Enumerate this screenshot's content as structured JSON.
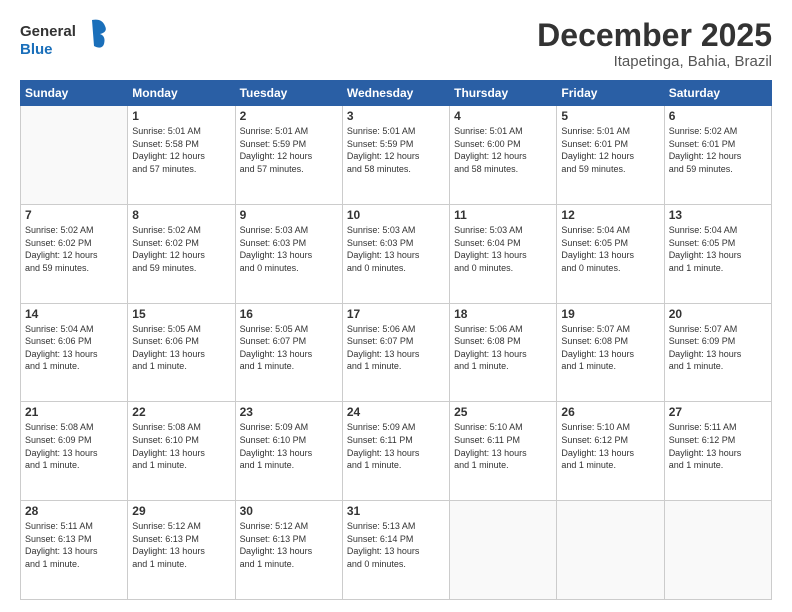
{
  "header": {
    "logo_line1": "General",
    "logo_line2": "Blue",
    "month": "December 2025",
    "location": "Itapetinga, Bahia, Brazil"
  },
  "weekdays": [
    "Sunday",
    "Monday",
    "Tuesday",
    "Wednesday",
    "Thursday",
    "Friday",
    "Saturday"
  ],
  "weeks": [
    [
      {
        "day": "",
        "info": ""
      },
      {
        "day": "1",
        "info": "Sunrise: 5:01 AM\nSunset: 5:58 PM\nDaylight: 12 hours\nand 57 minutes."
      },
      {
        "day": "2",
        "info": "Sunrise: 5:01 AM\nSunset: 5:59 PM\nDaylight: 12 hours\nand 57 minutes."
      },
      {
        "day": "3",
        "info": "Sunrise: 5:01 AM\nSunset: 5:59 PM\nDaylight: 12 hours\nand 58 minutes."
      },
      {
        "day": "4",
        "info": "Sunrise: 5:01 AM\nSunset: 6:00 PM\nDaylight: 12 hours\nand 58 minutes."
      },
      {
        "day": "5",
        "info": "Sunrise: 5:01 AM\nSunset: 6:01 PM\nDaylight: 12 hours\nand 59 minutes."
      },
      {
        "day": "6",
        "info": "Sunrise: 5:02 AM\nSunset: 6:01 PM\nDaylight: 12 hours\nand 59 minutes."
      }
    ],
    [
      {
        "day": "7",
        "info": "Sunrise: 5:02 AM\nSunset: 6:02 PM\nDaylight: 12 hours\nand 59 minutes."
      },
      {
        "day": "8",
        "info": "Sunrise: 5:02 AM\nSunset: 6:02 PM\nDaylight: 12 hours\nand 59 minutes."
      },
      {
        "day": "9",
        "info": "Sunrise: 5:03 AM\nSunset: 6:03 PM\nDaylight: 13 hours\nand 0 minutes."
      },
      {
        "day": "10",
        "info": "Sunrise: 5:03 AM\nSunset: 6:03 PM\nDaylight: 13 hours\nand 0 minutes."
      },
      {
        "day": "11",
        "info": "Sunrise: 5:03 AM\nSunset: 6:04 PM\nDaylight: 13 hours\nand 0 minutes."
      },
      {
        "day": "12",
        "info": "Sunrise: 5:04 AM\nSunset: 6:05 PM\nDaylight: 13 hours\nand 0 minutes."
      },
      {
        "day": "13",
        "info": "Sunrise: 5:04 AM\nSunset: 6:05 PM\nDaylight: 13 hours\nand 1 minute."
      }
    ],
    [
      {
        "day": "14",
        "info": "Sunrise: 5:04 AM\nSunset: 6:06 PM\nDaylight: 13 hours\nand 1 minute."
      },
      {
        "day": "15",
        "info": "Sunrise: 5:05 AM\nSunset: 6:06 PM\nDaylight: 13 hours\nand 1 minute."
      },
      {
        "day": "16",
        "info": "Sunrise: 5:05 AM\nSunset: 6:07 PM\nDaylight: 13 hours\nand 1 minute."
      },
      {
        "day": "17",
        "info": "Sunrise: 5:06 AM\nSunset: 6:07 PM\nDaylight: 13 hours\nand 1 minute."
      },
      {
        "day": "18",
        "info": "Sunrise: 5:06 AM\nSunset: 6:08 PM\nDaylight: 13 hours\nand 1 minute."
      },
      {
        "day": "19",
        "info": "Sunrise: 5:07 AM\nSunset: 6:08 PM\nDaylight: 13 hours\nand 1 minute."
      },
      {
        "day": "20",
        "info": "Sunrise: 5:07 AM\nSunset: 6:09 PM\nDaylight: 13 hours\nand 1 minute."
      }
    ],
    [
      {
        "day": "21",
        "info": "Sunrise: 5:08 AM\nSunset: 6:09 PM\nDaylight: 13 hours\nand 1 minute."
      },
      {
        "day": "22",
        "info": "Sunrise: 5:08 AM\nSunset: 6:10 PM\nDaylight: 13 hours\nand 1 minute."
      },
      {
        "day": "23",
        "info": "Sunrise: 5:09 AM\nSunset: 6:10 PM\nDaylight: 13 hours\nand 1 minute."
      },
      {
        "day": "24",
        "info": "Sunrise: 5:09 AM\nSunset: 6:11 PM\nDaylight: 13 hours\nand 1 minute."
      },
      {
        "day": "25",
        "info": "Sunrise: 5:10 AM\nSunset: 6:11 PM\nDaylight: 13 hours\nand 1 minute."
      },
      {
        "day": "26",
        "info": "Sunrise: 5:10 AM\nSunset: 6:12 PM\nDaylight: 13 hours\nand 1 minute."
      },
      {
        "day": "27",
        "info": "Sunrise: 5:11 AM\nSunset: 6:12 PM\nDaylight: 13 hours\nand 1 minute."
      }
    ],
    [
      {
        "day": "28",
        "info": "Sunrise: 5:11 AM\nSunset: 6:13 PM\nDaylight: 13 hours\nand 1 minute."
      },
      {
        "day": "29",
        "info": "Sunrise: 5:12 AM\nSunset: 6:13 PM\nDaylight: 13 hours\nand 1 minute."
      },
      {
        "day": "30",
        "info": "Sunrise: 5:12 AM\nSunset: 6:13 PM\nDaylight: 13 hours\nand 1 minute."
      },
      {
        "day": "31",
        "info": "Sunrise: 5:13 AM\nSunset: 6:14 PM\nDaylight: 13 hours\nand 0 minutes."
      },
      {
        "day": "",
        "info": ""
      },
      {
        "day": "",
        "info": ""
      },
      {
        "day": "",
        "info": ""
      }
    ]
  ]
}
